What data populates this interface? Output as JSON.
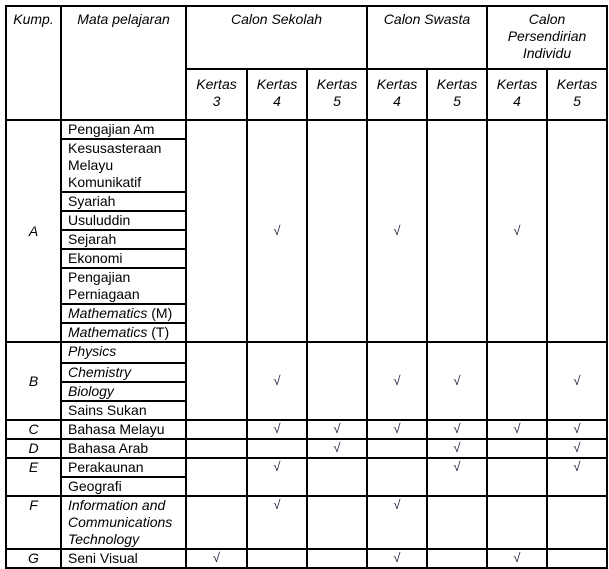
{
  "header": {
    "group_label": "Kump.",
    "subject_label": "Mata pelajaran",
    "categories": [
      {
        "label": "Calon Sekolah",
        "papers": [
          "Kertas 3",
          "Kertas 4",
          "Kertas 5"
        ]
      },
      {
        "label": "Calon Swasta",
        "papers": [
          "Kertas 4",
          "Kertas 5"
        ]
      },
      {
        "label": "Calon Persendirian Individu",
        "papers": [
          "Kertas 4",
          "Kertas 5"
        ]
      }
    ],
    "paper_word": "Kertas",
    "paper_numbers": [
      "3",
      "4",
      "5",
      "4",
      "5",
      "4",
      "5"
    ]
  },
  "check_symbol": "√",
  "groups": [
    {
      "group": "A",
      "subjects": [
        {
          "name": "Pengajian Am",
          "italic": false
        },
        {
          "name": "Kesusasteraan Melayu Komunikatif",
          "italic": false
        },
        {
          "name": "Syariah",
          "italic": false
        },
        {
          "name": "Usuluddin",
          "italic": false
        },
        {
          "name": "Sejarah",
          "italic": false
        },
        {
          "name": "Ekonomi",
          "italic": false
        },
        {
          "name": "Pengajian Perniagaan",
          "italic": false
        },
        {
          "name": "Mathematics",
          "suffix": "(M)",
          "italic": true
        },
        {
          "name": "Mathematics",
          "suffix": "(T)",
          "italic": true
        }
      ],
      "checks": [
        false,
        true,
        false,
        true,
        false,
        true,
        false
      ]
    },
    {
      "group": "B",
      "subjects": [
        {
          "name": "Physics",
          "italic": true
        },
        {
          "name": "Chemistry",
          "italic": true
        },
        {
          "name": "Biology",
          "italic": true
        },
        {
          "name": "Sains Sukan",
          "italic": false
        }
      ],
      "checks": [
        false,
        true,
        false,
        true,
        true,
        false,
        true
      ]
    },
    {
      "group": "C",
      "subjects": [
        {
          "name": "Bahasa Melayu",
          "italic": false
        }
      ],
      "checks": [
        false,
        true,
        true,
        true,
        true,
        true,
        true
      ]
    },
    {
      "group": "D",
      "subjects": [
        {
          "name": "Bahasa Arab",
          "italic": false
        }
      ],
      "checks": [
        false,
        false,
        true,
        false,
        true,
        false,
        true
      ]
    },
    {
      "group": "E",
      "subjects": [
        {
          "name": "Perakaunan",
          "italic": false
        },
        {
          "name": "Geografi",
          "italic": false
        }
      ],
      "checks": [
        false,
        true,
        false,
        false,
        true,
        false,
        true
      ]
    },
    {
      "group": "F",
      "subjects": [
        {
          "name": "Information and Communications Technology",
          "italic": true
        }
      ],
      "checks": [
        false,
        true,
        false,
        true,
        false,
        false,
        false
      ]
    },
    {
      "group": "G",
      "subjects": [
        {
          "name": "Seni Visual",
          "italic": false
        }
      ],
      "checks": [
        true,
        false,
        false,
        true,
        false,
        true,
        false
      ]
    }
  ]
}
